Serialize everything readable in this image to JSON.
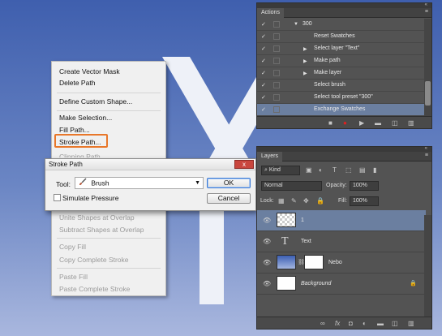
{
  "context_menu": {
    "items": [
      {
        "label": "Create Vector Mask",
        "enabled": true
      },
      {
        "label": "Delete Path",
        "enabled": true
      },
      {
        "label": "Define Custom Shape...",
        "enabled": true
      },
      {
        "label": "Make Selection...",
        "enabled": true
      },
      {
        "label": "Fill Path...",
        "enabled": true
      },
      {
        "label": "Stroke Path...",
        "enabled": true
      },
      {
        "label": "Clipping Path...",
        "enabled": false
      },
      {
        "label": "Unite Shapes at Overlap",
        "enabled": false
      },
      {
        "label": "Subtract Shapes at Overlap",
        "enabled": false
      },
      {
        "label": "Copy Fill",
        "enabled": false
      },
      {
        "label": "Copy Complete Stroke",
        "enabled": false
      },
      {
        "label": "Paste Fill",
        "enabled": false
      },
      {
        "label": "Paste Complete Stroke",
        "enabled": false
      }
    ]
  },
  "stroke_dialog": {
    "title": "Stroke Path",
    "tool_label": "Tool:",
    "tool_value": "Brush",
    "simulate_label": "Simulate Pressure",
    "simulate_checked": false,
    "ok_label": "OK",
    "cancel_label": "Cancel",
    "close_glyph": "x"
  },
  "actions_panel": {
    "tab": "Actions",
    "rows": [
      {
        "label": "300",
        "checked": true,
        "expand": "open"
      },
      {
        "label": "Reset Swatches",
        "checked": true,
        "expand": "none"
      },
      {
        "label": "Select layer \"Text\"",
        "checked": true,
        "expand": "closed"
      },
      {
        "label": "Make path",
        "checked": true,
        "expand": "closed"
      },
      {
        "label": "Make layer",
        "checked": true,
        "expand": "closed"
      },
      {
        "label": "Select brush",
        "checked": true,
        "expand": "none"
      },
      {
        "label": "Select tool preset \"300\"",
        "checked": true,
        "expand": "none"
      },
      {
        "label": "Exchange Swatches",
        "checked": true,
        "expand": "none",
        "selected": true
      }
    ],
    "record_color": "#e02020"
  },
  "layers_panel": {
    "tab": "Layers",
    "filter_label": "Kind",
    "blend_mode": "Normal",
    "opacity_label": "Opacity:",
    "opacity_value": "100%",
    "lock_label": "Lock:",
    "fill_label": "Fill:",
    "fill_value": "100%",
    "layers": [
      {
        "name": "1",
        "type": "transparent",
        "selected": true
      },
      {
        "name": "Text",
        "type": "text"
      },
      {
        "name": "Nebo",
        "type": "masked"
      },
      {
        "name": "Background",
        "type": "background",
        "locked": true
      }
    ],
    "footer_fx": "fx"
  },
  "colors": {
    "highlight_outline": "#e8772a",
    "selection": "#6b7fa0",
    "panel_bg": "#535353"
  }
}
